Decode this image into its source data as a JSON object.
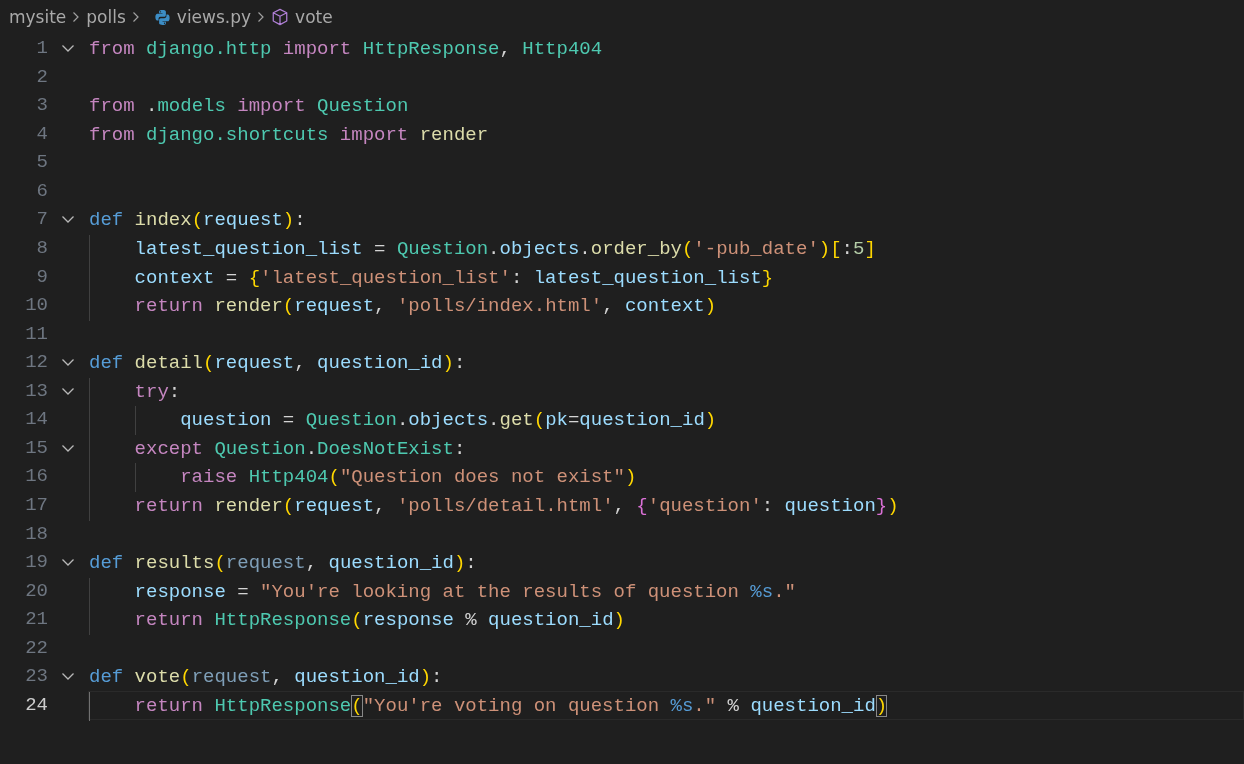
{
  "breadcrumbs": [
    {
      "label": "mysite",
      "kind": "folder"
    },
    {
      "label": "polls",
      "kind": "folder"
    },
    {
      "label": "views.py",
      "kind": "python-file"
    },
    {
      "label": "vote",
      "kind": "function"
    }
  ],
  "lines": [
    {
      "number": "1",
      "foldable": true,
      "current": false,
      "tokens": [
        {
          "text": "from ",
          "kind": "keyword"
        },
        {
          "text": "django.http ",
          "kind": "module"
        },
        {
          "text": "import ",
          "kind": "keyword"
        },
        {
          "text": "HttpResponse",
          "kind": "class"
        },
        {
          "text": ", ",
          "kind": "plain"
        },
        {
          "text": "Http404",
          "kind": "class"
        }
      ]
    },
    {
      "number": "2",
      "foldable": false,
      "current": false
    },
    {
      "number": "3",
      "foldable": false,
      "current": false,
      "tokens": [
        {
          "text": "from ",
          "kind": "keyword"
        },
        {
          "text": ".",
          "kind": "plain"
        },
        {
          "text": "models ",
          "kind": "module"
        },
        {
          "text": "import ",
          "kind": "keyword"
        },
        {
          "text": "Question",
          "kind": "class"
        }
      ]
    },
    {
      "number": "4",
      "foldable": false,
      "current": false,
      "tokens": [
        {
          "text": "from ",
          "kind": "keyword"
        },
        {
          "text": "django.shortcuts ",
          "kind": "module"
        },
        {
          "text": "import ",
          "kind": "keyword"
        },
        {
          "text": "render",
          "kind": "function"
        }
      ]
    },
    {
      "number": "5",
      "foldable": false,
      "current": false
    },
    {
      "number": "6",
      "foldable": false,
      "current": false
    },
    {
      "number": "7",
      "foldable": true,
      "current": false,
      "tokens": [
        {
          "text": "def ",
          "kind": "storage"
        },
        {
          "text": "index",
          "kind": "function"
        },
        {
          "text": "(",
          "kind": "bracket1"
        },
        {
          "text": "request",
          "kind": "variable"
        },
        {
          "text": ")",
          "kind": "bracket1"
        },
        {
          "text": ":",
          "kind": "plain"
        }
      ]
    },
    {
      "number": "8",
      "foldable": false,
      "current": false,
      "tokens": [
        {
          "text": "    latest_question_list",
          "kind": "variable"
        },
        {
          "text": " = ",
          "kind": "plain"
        },
        {
          "text": "Question",
          "kind": "class"
        },
        {
          "text": ".",
          "kind": "plain"
        },
        {
          "text": "objects",
          "kind": "variable"
        },
        {
          "text": ".",
          "kind": "plain"
        },
        {
          "text": "order_by",
          "kind": "function"
        },
        {
          "text": "(",
          "kind": "bracket1"
        },
        {
          "text": "'-pub_date'",
          "kind": "string"
        },
        {
          "text": ")",
          "kind": "bracket1"
        },
        {
          "text": "[",
          "kind": "bracket1"
        },
        {
          "text": ":",
          "kind": "plain"
        },
        {
          "text": "5",
          "kind": "number"
        },
        {
          "text": "]",
          "kind": "bracket1"
        }
      ]
    },
    {
      "number": "9",
      "foldable": false,
      "current": false,
      "tokens": [
        {
          "text": "    context",
          "kind": "variable"
        },
        {
          "text": " = ",
          "kind": "plain"
        },
        {
          "text": "{",
          "kind": "bracket1"
        },
        {
          "text": "'latest_question_list'",
          "kind": "string"
        },
        {
          "text": ": ",
          "kind": "plain"
        },
        {
          "text": "latest_question_list",
          "kind": "variable"
        },
        {
          "text": "}",
          "kind": "bracket1"
        }
      ]
    },
    {
      "number": "10",
      "foldable": false,
      "current": false,
      "tokens": [
        {
          "text": "    return ",
          "kind": "keyword"
        },
        {
          "text": "render",
          "kind": "function"
        },
        {
          "text": "(",
          "kind": "bracket1"
        },
        {
          "text": "request",
          "kind": "variable"
        },
        {
          "text": ", ",
          "kind": "plain"
        },
        {
          "text": "'polls/index.html'",
          "kind": "string"
        },
        {
          "text": ", ",
          "kind": "plain"
        },
        {
          "text": "context",
          "kind": "variable"
        },
        {
          "text": ")",
          "kind": "bracket1"
        }
      ]
    },
    {
      "number": "11",
      "foldable": false,
      "current": false
    },
    {
      "number": "12",
      "foldable": true,
      "current": false,
      "tokens": [
        {
          "text": "def ",
          "kind": "storage"
        },
        {
          "text": "detail",
          "kind": "function"
        },
        {
          "text": "(",
          "kind": "bracket1"
        },
        {
          "text": "request",
          "kind": "variable"
        },
        {
          "text": ", ",
          "kind": "plain"
        },
        {
          "text": "question_id",
          "kind": "variable"
        },
        {
          "text": ")",
          "kind": "bracket1"
        },
        {
          "text": ":",
          "kind": "plain"
        }
      ]
    },
    {
      "number": "13",
      "foldable": true,
      "current": false,
      "tokens": [
        {
          "text": "    try",
          "kind": "keyword"
        },
        {
          "text": ":",
          "kind": "plain"
        }
      ]
    },
    {
      "number": "14",
      "foldable": false,
      "current": false,
      "tokens": [
        {
          "text": "        question",
          "kind": "variable"
        },
        {
          "text": " = ",
          "kind": "plain"
        },
        {
          "text": "Question",
          "kind": "class"
        },
        {
          "text": ".",
          "kind": "plain"
        },
        {
          "text": "objects",
          "kind": "variable"
        },
        {
          "text": ".",
          "kind": "plain"
        },
        {
          "text": "get",
          "kind": "function"
        },
        {
          "text": "(",
          "kind": "bracket1"
        },
        {
          "text": "pk",
          "kind": "variable"
        },
        {
          "text": "=",
          "kind": "plain"
        },
        {
          "text": "question_id",
          "kind": "variable"
        },
        {
          "text": ")",
          "kind": "bracket1"
        }
      ]
    },
    {
      "number": "15",
      "foldable": true,
      "current": false,
      "tokens": [
        {
          "text": "    except ",
          "kind": "keyword"
        },
        {
          "text": "Question",
          "kind": "class"
        },
        {
          "text": ".",
          "kind": "plain"
        },
        {
          "text": "DoesNotExist",
          "kind": "class"
        },
        {
          "text": ":",
          "kind": "plain"
        }
      ]
    },
    {
      "number": "16",
      "foldable": false,
      "current": false,
      "tokens": [
        {
          "text": "        raise ",
          "kind": "keyword"
        },
        {
          "text": "Http404",
          "kind": "class"
        },
        {
          "text": "(",
          "kind": "bracket1"
        },
        {
          "text": "\"Question does not exist\"",
          "kind": "string"
        },
        {
          "text": ")",
          "kind": "bracket1"
        }
      ]
    },
    {
      "number": "17",
      "foldable": false,
      "current": false,
      "tokens": [
        {
          "text": "    return ",
          "kind": "keyword"
        },
        {
          "text": "render",
          "kind": "function"
        },
        {
          "text": "(",
          "kind": "bracket1"
        },
        {
          "text": "request",
          "kind": "variable"
        },
        {
          "text": ", ",
          "kind": "plain"
        },
        {
          "text": "'polls/detail.html'",
          "kind": "string"
        },
        {
          "text": ", ",
          "kind": "plain"
        },
        {
          "text": "{",
          "kind": "bracket2"
        },
        {
          "text": "'question'",
          "kind": "string"
        },
        {
          "text": ": ",
          "kind": "plain"
        },
        {
          "text": "question",
          "kind": "variable"
        },
        {
          "text": "}",
          "kind": "bracket2"
        },
        {
          "text": ")",
          "kind": "bracket1"
        }
      ]
    },
    {
      "number": "18",
      "foldable": false,
      "current": false
    },
    {
      "number": "19",
      "foldable": true,
      "current": false,
      "tokens": [
        {
          "text": "def ",
          "kind": "storage"
        },
        {
          "text": "results",
          "kind": "function"
        },
        {
          "text": "(",
          "kind": "bracket1"
        },
        {
          "text": "request",
          "kind": "unused"
        },
        {
          "text": ", ",
          "kind": "plain"
        },
        {
          "text": "question_id",
          "kind": "variable"
        },
        {
          "text": ")",
          "kind": "bracket1"
        },
        {
          "text": ":",
          "kind": "plain"
        }
      ]
    },
    {
      "number": "20",
      "foldable": false,
      "current": false,
      "tokens": [
        {
          "text": "    response",
          "kind": "variable"
        },
        {
          "text": " = ",
          "kind": "plain"
        },
        {
          "text": "\"You're looking at the results of question ",
          "kind": "string"
        },
        {
          "text": "%s",
          "kind": "format"
        },
        {
          "text": ".\"",
          "kind": "string"
        }
      ]
    },
    {
      "number": "21",
      "foldable": false,
      "current": false,
      "tokens": [
        {
          "text": "    return ",
          "kind": "keyword"
        },
        {
          "text": "HttpResponse",
          "kind": "class"
        },
        {
          "text": "(",
          "kind": "bracket1"
        },
        {
          "text": "response",
          "kind": "variable"
        },
        {
          "text": " % ",
          "kind": "plain"
        },
        {
          "text": "question_id",
          "kind": "variable"
        },
        {
          "text": ")",
          "kind": "bracket1"
        }
      ]
    },
    {
      "number": "22",
      "foldable": false,
      "current": false
    },
    {
      "number": "23",
      "foldable": true,
      "current": false,
      "tokens": [
        {
          "text": "def ",
          "kind": "storage"
        },
        {
          "text": "vote",
          "kind": "function"
        },
        {
          "text": "(",
          "kind": "bracket1"
        },
        {
          "text": "request",
          "kind": "unused"
        },
        {
          "text": ", ",
          "kind": "plain"
        },
        {
          "text": "question_id",
          "kind": "variable"
        },
        {
          "text": ")",
          "kind": "bracket1"
        },
        {
          "text": ":",
          "kind": "plain"
        }
      ]
    },
    {
      "number": "24",
      "foldable": false,
      "current": true,
      "tokens": [
        {
          "text": "    return ",
          "kind": "keyword"
        },
        {
          "text": "HttpResponse",
          "kind": "class"
        },
        {
          "text": "(",
          "kind": "match"
        },
        {
          "text": "\"You're voting on question ",
          "kind": "string"
        },
        {
          "text": "%s",
          "kind": "format"
        },
        {
          "text": ".\"",
          "kind": "string"
        },
        {
          "text": " % ",
          "kind": "plain"
        },
        {
          "text": "question_id",
          "kind": "variable"
        },
        {
          "text": ")",
          "kind": "match"
        }
      ]
    }
  ]
}
